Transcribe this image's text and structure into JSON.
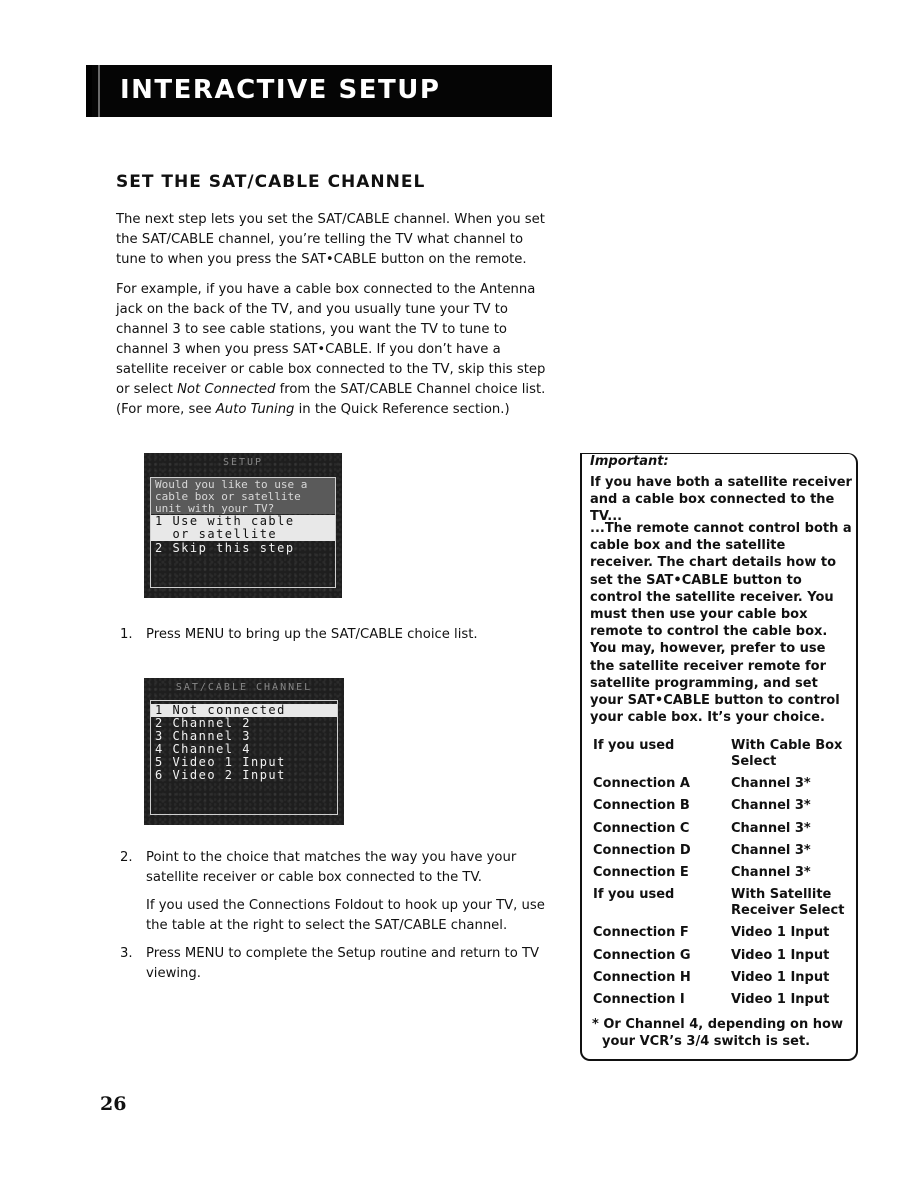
{
  "header": {
    "title": "INTERACTIVE SETUP"
  },
  "section": {
    "title": "SET THE SAT/CABLE CHANNEL"
  },
  "intro": {
    "p1": "The next step lets you set the SAT/CABLE channel. When you set the SAT/CABLE channel, you’re telling the TV what channel to tune to when you press the SAT•CABLE button on the remote.",
    "p2_a": "For example, if you have a cable box connected to the Antenna jack on the back of the TV, and you usually tune your TV to channel 3 to see cable stations, you want the TV to tune to channel 3 when you press SAT•CABLE. If you don’t have a satellite receiver or cable box connected to the TV, skip this step or select ",
    "p2_em1": "Not Connected",
    "p2_b": " from the SAT/CABLE Channel choice list. (For more, see ",
    "p2_em2": "Auto Tuning",
    "p2_c": " in the Quick Reference section.)"
  },
  "screen1": {
    "title": "SETUP",
    "prompt": "Would you like to use a cable box or satellite unit with your TV?",
    "options": [
      "1 Use with cable\n  or satellite",
      "2 Skip this step"
    ],
    "selected_index": 0
  },
  "screen2": {
    "title": "SAT/CABLE CHANNEL",
    "options": [
      "1 Not connected",
      "2 Channel 2",
      "3 Channel 3",
      "4 Channel 4",
      "5 Video 1 Input",
      "6 Video 2 Input"
    ],
    "selected_index": 0
  },
  "steps": [
    {
      "num": "1.",
      "text": "Press MENU to bring up the SAT/CABLE choice list."
    },
    {
      "num": "2.",
      "text": "Point to the choice that matches the way you have your satellite receiver or cable box connected to the TV.",
      "extra": "If you used the Connections Foldout to hook up your TV, use the table at the right to select the SAT/CABLE channel."
    },
    {
      "num": "3.",
      "text": "Press MENU to complete the Setup routine and return to TV viewing."
    }
  ],
  "callout": {
    "label": "Important:",
    "lead": "If you have both a satellite receiver and a cable box connected to the TV...",
    "body": "...The remote cannot control both a cable box and the satellite receiver. The chart details how to set the SAT•CABLE button to control the satellite receiver. You must then use your cable box remote to control the cable box. You may, however, prefer to use the satellite receiver remote for satellite programming, and set your SAT•CABLE button to control your cable box. It’s your choice.",
    "table1": {
      "headers": [
        "If you used",
        "With Cable Box Select"
      ],
      "rows": [
        [
          "Connection A",
          "Channel 3*"
        ],
        [
          "Connection B",
          "Channel 3*"
        ],
        [
          "Connection C",
          "Channel 3*"
        ],
        [
          "Connection D",
          "Channel 3*"
        ],
        [
          "Connection E",
          "Channel 3*"
        ]
      ]
    },
    "table2": {
      "headers": [
        "If you used",
        "With Satellite Receiver Select"
      ],
      "rows": [
        [
          "Connection F",
          "Video 1 Input"
        ],
        [
          "Connection G",
          "Video 1 Input"
        ],
        [
          "Connection H",
          "Video 1 Input"
        ],
        [
          "Connection I",
          "Video 1 Input"
        ]
      ]
    },
    "footnote": "* Or Channel 4, depending on how your VCR’s 3/4 switch is set."
  },
  "page_number": "26"
}
